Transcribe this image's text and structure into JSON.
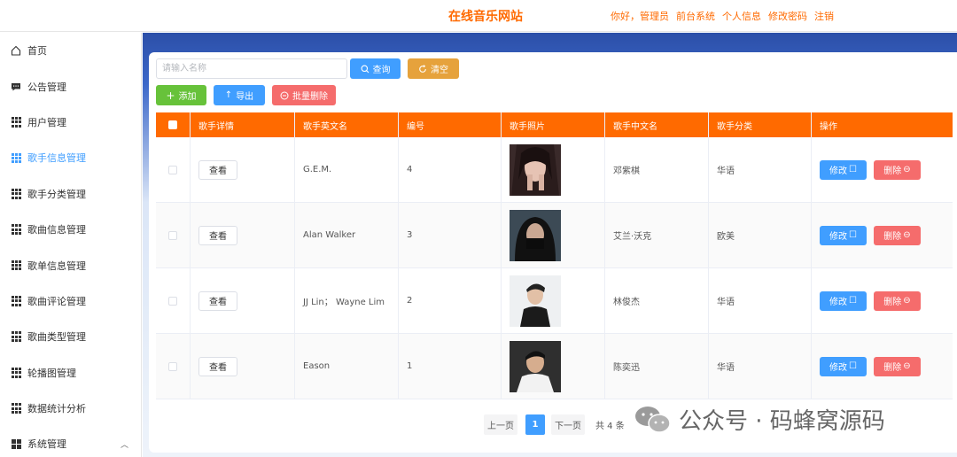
{
  "header": {
    "site_title": "在线音乐网站",
    "links": [
      "你好，管理员",
      "前台系统",
      "个人信息",
      "修改密码",
      "注销"
    ]
  },
  "sidebar": {
    "items": [
      {
        "label": "首页",
        "icon": "home-icon"
      },
      {
        "label": "公告管理",
        "icon": "message-icon"
      },
      {
        "label": "用户管理",
        "icon": "grid-icon"
      },
      {
        "label": "歌手信息管理",
        "icon": "grid-icon",
        "active": true
      },
      {
        "label": "歌手分类管理",
        "icon": "grid-icon"
      },
      {
        "label": "歌曲信息管理",
        "icon": "grid-icon"
      },
      {
        "label": "歌单信息管理",
        "icon": "grid-icon"
      },
      {
        "label": "歌曲评论管理",
        "icon": "grid-icon"
      },
      {
        "label": "歌曲类型管理",
        "icon": "grid-icon"
      },
      {
        "label": "轮播图管理",
        "icon": "grid-icon"
      },
      {
        "label": "数据统计分析",
        "icon": "grid-icon"
      },
      {
        "label": "系统管理",
        "icon": "grid4-icon"
      }
    ]
  },
  "toolbar": {
    "search_placeholder": "请输入名称",
    "search_label": "查询",
    "reset_label": "清空",
    "add_label": "添加",
    "export_label": "导出",
    "batch_delete_label": "批量删除"
  },
  "table": {
    "headers": [
      "歌手详情",
      "歌手英文名",
      "编号",
      "歌手照片",
      "歌手中文名",
      "歌手分类",
      "操作"
    ],
    "view_label": "查看",
    "edit_label": "修改",
    "delete_label": "删除",
    "rows": [
      {
        "english_name": "G.E.M.",
        "id": "4",
        "chinese_name": "邓紫棋",
        "category": "华语"
      },
      {
        "english_name": "Alan Walker",
        "id": "3",
        "chinese_name": "艾兰·沃克",
        "category": "欧美"
      },
      {
        "english_name": "JJ Lin； Wayne Lim",
        "id": "2",
        "chinese_name": "林俊杰",
        "category": "华语"
      },
      {
        "english_name": "Eason",
        "id": "1",
        "chinese_name": "陈奕迅",
        "category": "华语"
      }
    ]
  },
  "pager": {
    "prev_label": "上一页",
    "current_page": "1",
    "next_label": "下一页",
    "total_label": "共 4 条"
  },
  "watermark": {
    "text": "公众号 · 码蜂窝源码"
  },
  "colors": {
    "accent": "#ff6a00",
    "primary": "#409eff",
    "danger": "#f56c6c",
    "success": "#67c23a",
    "warning": "#e6a23c"
  }
}
